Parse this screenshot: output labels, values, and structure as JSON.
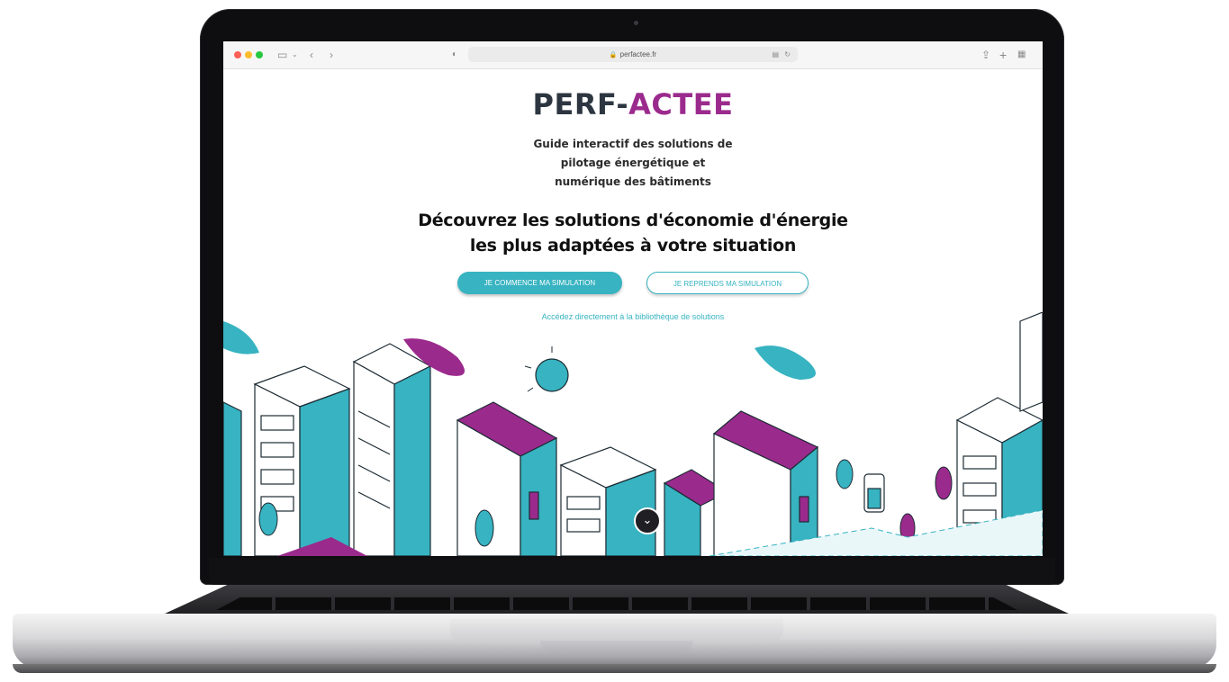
{
  "browser": {
    "url": "perfactee.fr",
    "translate_icon": "translate-icon",
    "reload_icon": "reload-icon",
    "icons": [
      "sidebar-icon",
      "chevron-down-icon",
      "back-icon",
      "forward-icon",
      "shield-icon",
      "share-icon",
      "new-tab-icon",
      "tabs-overview-icon"
    ]
  },
  "page": {
    "logo_part1": "PERF-",
    "logo_part2": "ACTEE",
    "subtitle_line1": "Guide interactif des solutions de",
    "subtitle_line2": "pilotage énergétique et",
    "subtitle_line3": "numérique des bâtiments",
    "headline_line1": "Découvrez les solutions d'économie d'énergie",
    "headline_line2": "les plus adaptées à votre situation",
    "primary_button": "JE COMMENCE MA SIMULATION",
    "secondary_button": "JE REPRENDS MA SIMULATION",
    "library_link": "Accédez directement à la bibliothèque de solutions"
  },
  "colors": {
    "teal": "#37b3c1",
    "purple": "#9b2a8d",
    "dark": "#2d3640"
  }
}
